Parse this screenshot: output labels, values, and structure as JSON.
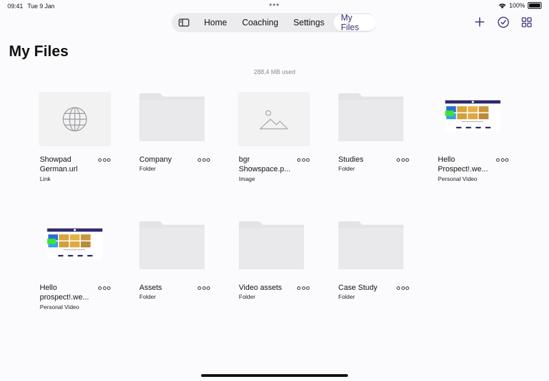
{
  "status": {
    "time": "09:41",
    "date": "Tue 9 Jan",
    "battery": "100%"
  },
  "nav": {
    "tabs": [
      {
        "label": "Home"
      },
      {
        "label": "Coaching"
      },
      {
        "label": "Settings"
      },
      {
        "label": "My Files"
      }
    ],
    "active": "My Files"
  },
  "page": {
    "title": "My Files",
    "usage": "288,4 MB used"
  },
  "files": [
    {
      "name_lines": [
        "Showpad",
        "German.url"
      ],
      "kind": "Link",
      "thumb": "globe"
    },
    {
      "name_lines": [
        "Company"
      ],
      "kind": "Folder",
      "thumb": "folder"
    },
    {
      "name_lines": [
        "bgr",
        "Showspace.p..."
      ],
      "kind": "Image",
      "thumb": "image"
    },
    {
      "name_lines": [
        "Studies"
      ],
      "kind": "Folder",
      "thumb": "folder"
    },
    {
      "name_lines": [
        "Hello",
        "Prospect!.we..."
      ],
      "kind": "Personal Video",
      "thumb": "video"
    },
    {
      "name_lines": [
        "Hello",
        "prospect!.we..."
      ],
      "kind": "Personal Video",
      "thumb": "video"
    },
    {
      "name_lines": [
        "Assets"
      ],
      "kind": "Folder",
      "thumb": "folder"
    },
    {
      "name_lines": [
        "Video assets"
      ],
      "kind": "Folder",
      "thumb": "folder"
    },
    {
      "name_lines": [
        "Case Study"
      ],
      "kind": "Folder",
      "thumb": "folder"
    }
  ],
  "colors": {
    "accent": "#3a3078",
    "folder": "#e2e2e4",
    "background": "#fbfbfd"
  }
}
